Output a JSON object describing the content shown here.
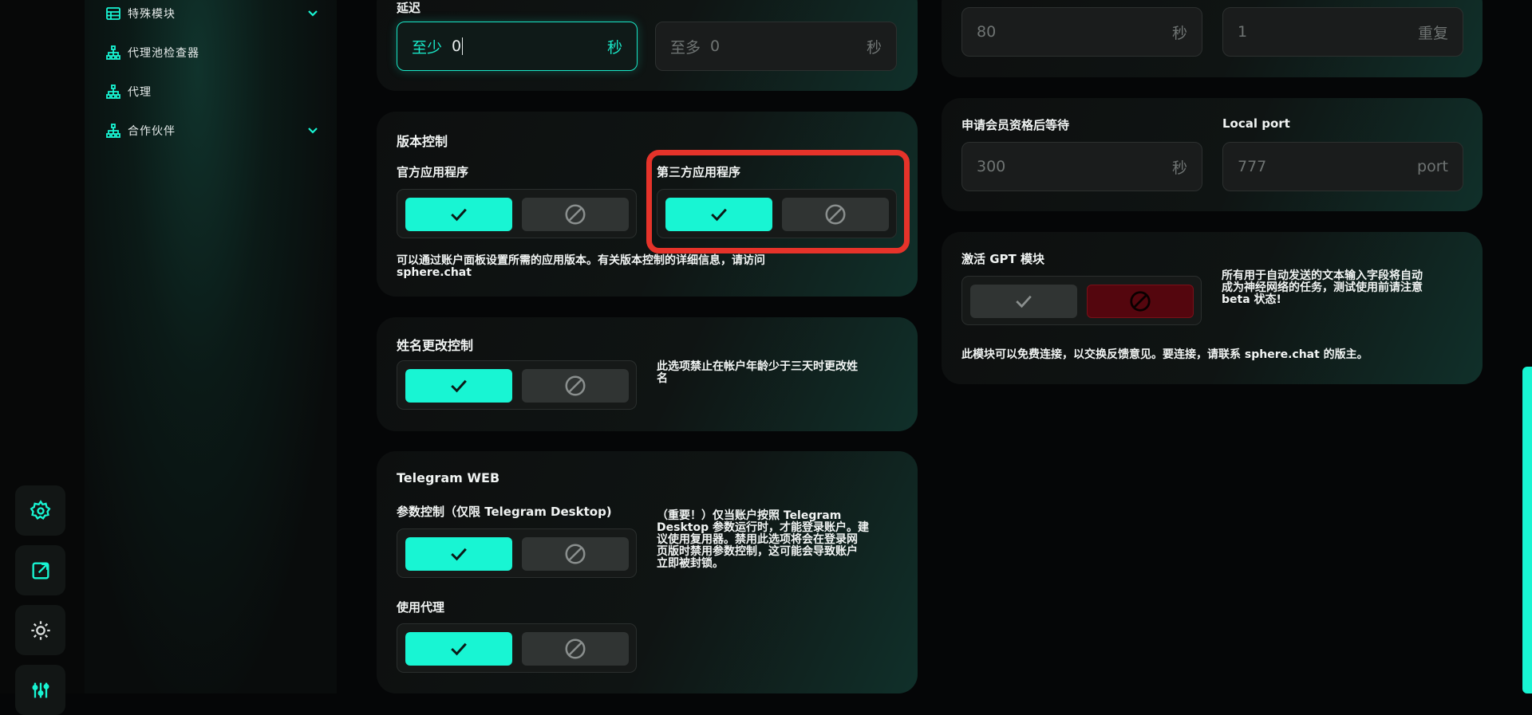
{
  "sidebar": {
    "items": [
      {
        "label": "特殊模块",
        "icon": "table-icon",
        "expandable": true
      },
      {
        "label": "代理池检查器",
        "icon": "hierarchy-icon",
        "expandable": false
      },
      {
        "label": "代理",
        "icon": "hierarchy-icon",
        "expandable": false
      },
      {
        "label": "合作伙伴",
        "icon": "hierarchy-icon",
        "expandable": true
      }
    ]
  },
  "rail": {
    "icons": [
      "gear-icon",
      "external-link-icon",
      "theme-toggle-icon",
      "sliders-icon"
    ]
  },
  "delay": {
    "title": "延迟",
    "min_prefix": "至少",
    "min_value": "0",
    "min_unit": "秒",
    "max_prefix": "至多",
    "max_value": "0",
    "max_unit": "秒"
  },
  "top_right": {
    "left_value": "80",
    "left_unit": "秒",
    "right_value": "1",
    "right_unit": "重复"
  },
  "version_control": {
    "title": "版本控制",
    "official_label": "官方应用程序",
    "third_party_label": "第三方应用程序",
    "description_line1": "可以通过账户面板设置所需的应用版本。有关版本控制的详细信息，请访问",
    "description_line2": "sphere.chat"
  },
  "membership": {
    "wait_label": "申请会员资格后等待",
    "wait_value": "300",
    "wait_unit": "秒",
    "port_label": "Local port",
    "port_value": "777",
    "port_unit": "port"
  },
  "gpt": {
    "title": "激活 GPT 模块",
    "side_line1": "所有用于自动发送的文本输入字段将自动",
    "side_line2": "成为神经网络的任务，测试使用前请注意",
    "side_line3": "beta 状态!",
    "footer": "此模块可以免费连接，以交换反馈意见。要连接，请联系 sphere.chat 的版主。"
  },
  "name_change": {
    "title": "姓名更改控制",
    "desc_line1": "此选项禁止在帐户年龄少于三天时更改姓",
    "desc_line2": "名"
  },
  "telegram_web": {
    "title": "Telegram WEB",
    "param_label": "参数控制（仅限 Telegram Desktop)",
    "proxy_label": "使用代理",
    "desc_line1": "（重要！）仅当账户按照 Telegram",
    "desc_line2": "Desktop 参数运行时，才能登录账户。建",
    "desc_line3": "议使用复用器。禁用此选项将会在登录网",
    "desc_line4": "页版时禁用参数控制，这可能会导致账户",
    "desc_line5": "立即被封锁。"
  },
  "colors": {
    "accent": "#18f5d3",
    "highlight": "#e5332a",
    "danger": "#54060e"
  }
}
